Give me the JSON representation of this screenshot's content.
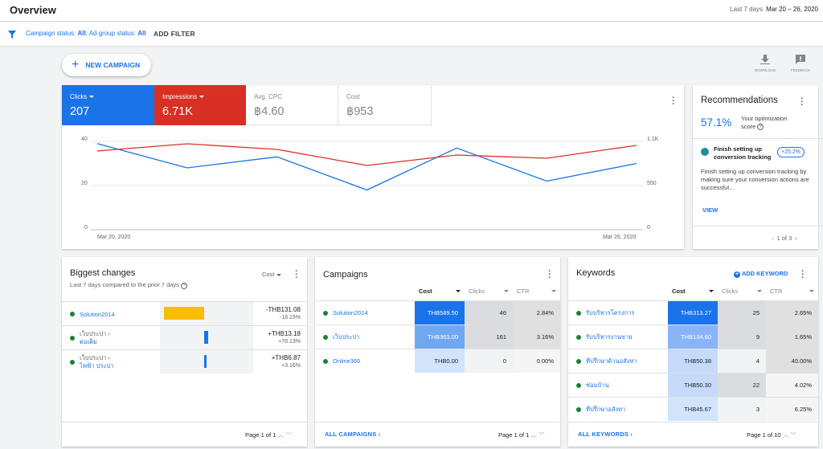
{
  "header": {
    "title": "Overview",
    "range_label": "Last 7 days",
    "range_value": "Mar 20 – 26, 2020"
  },
  "filters": {
    "campaign_status_label": "Campaign status: ",
    "campaign_status_value": "All",
    "ad_group_label": "; Ad group status: ",
    "ad_group_value": "All",
    "add_filter": "ADD FILTER"
  },
  "toolbar": {
    "new_campaign": "NEW CAMPAIGN",
    "download": "DOWNLOAD",
    "feedback": "FEEDBACK"
  },
  "colors": {
    "blue": "#1a73e8",
    "red": "#d93025",
    "green": "#188038",
    "yellow": "#fbbc04"
  },
  "metrics": [
    {
      "label": "Clicks",
      "value": "207"
    },
    {
      "label": "Impressions",
      "value": "6.71K"
    },
    {
      "label": "Avg. CPC",
      "value": "฿4.60"
    },
    {
      "label": "Cost",
      "value": "฿953"
    }
  ],
  "chart_data": {
    "type": "line",
    "x": [
      "Mar 20, 2020",
      "Mar 21, 2020",
      "Mar 22, 2020",
      "Mar 23, 2020",
      "Mar 24, 2020",
      "Mar 25, 2020",
      "Mar 26, 2020"
    ],
    "x_tick_labels": [
      "Mar 20, 2020",
      "Mar 26, 2020"
    ],
    "left_ticks": [
      "40",
      "20",
      "0"
    ],
    "right_ticks": [
      "1.1K",
      "550",
      "0"
    ],
    "left_ylim": [
      0,
      40
    ],
    "right_ylim": [
      0,
      1100
    ],
    "series": [
      {
        "name": "Clicks",
        "axis": "left",
        "color": "#1a73e8",
        "values": [
          39,
          28,
          33,
          18,
          37,
          22,
          30
        ]
      },
      {
        "name": "Impressions",
        "axis": "right",
        "color": "#d93025",
        "values": [
          980,
          1070,
          1000,
          800,
          930,
          890,
          1050
        ]
      }
    ]
  },
  "recommendations": {
    "title": "Recommendations",
    "score": "57.1%",
    "score_label": "Your optimization score",
    "item_title": "Finish setting up conversion tracking",
    "item_badge": "+25.2%",
    "item_desc": "Finish setting up conversion tracking by making sure your conversion actions are successful…",
    "view": "VIEW",
    "page": "1 of 3"
  },
  "biggest": {
    "title": "Biggest changes",
    "subtitle": "Last 7 days compared to the prior 7 days",
    "metric": "Cost",
    "rows": [
      {
        "line1": "Solution2014",
        "line2": "",
        "value": "-THB131.08",
        "pct": "-18.19%",
        "bar": 0.38
      },
      {
        "line1": "เว็บประปา ›",
        "line2": "ต่อเติม",
        "value": "+THB13.18",
        "pct": "+78.13%",
        "bar": 0.04
      },
      {
        "line1": "เว็บประปา ›",
        "line2": "ไฟฟ้า ประปา",
        "value": "+THB6.87",
        "pct": "+3.16%",
        "bar": 0.02
      }
    ],
    "page": "Page 1 of 1"
  },
  "campaigns": {
    "title": "Campaigns",
    "headers": [
      "Cost",
      "Clicks",
      "CTR"
    ],
    "rows": [
      {
        "name": "Solution2014",
        "cost": "THB589.50",
        "clicks": "46",
        "ctr": "2.84%"
      },
      {
        "name": "เว็บประปา",
        "cost": "THB363.00",
        "clicks": "161",
        "ctr": "3.16%"
      },
      {
        "name": "Online360",
        "cost": "THB0.00",
        "clicks": "0",
        "ctr": "0.00%"
      }
    ],
    "footer": "ALL CAMPAIGNS",
    "page": "Page 1 of 1"
  },
  "keywords": {
    "title": "Keywords",
    "add": "ADD KEYWORD",
    "headers": [
      "Cost",
      "Clicks",
      "CTR"
    ],
    "rows": [
      {
        "name": "รับบริหารโครงการ",
        "cost": "THB313.27",
        "clicks": "25",
        "ctr": "2.65%"
      },
      {
        "name": "รับบริหารงานขาย",
        "cost": "THB134.60",
        "clicks": "9",
        "ctr": "1.65%"
      },
      {
        "name": "ที่ปรึกษาด้านอสังหา",
        "cost": "THB50.38",
        "clicks": "4",
        "ctr": "40.00%"
      },
      {
        "name": "ซ่อมบ้าน",
        "cost": "THB50.30",
        "clicks": "22",
        "ctr": "4.02%"
      },
      {
        "name": "ที่ปรึกษาอสังหา",
        "cost": "THB45.67",
        "clicks": "3",
        "ctr": "6.25%"
      }
    ],
    "footer": "ALL KEYWORDS",
    "page": "Page 1 of 10"
  }
}
